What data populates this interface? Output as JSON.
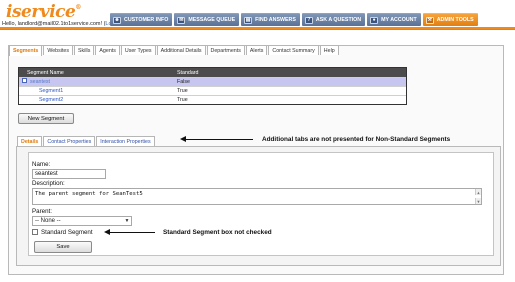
{
  "header": {
    "logo_prefix": "i",
    "logo_text": "service",
    "logo_mark": "®",
    "greeting": "Hello, landlord@mail02.1to1service.com!",
    "logout_open": " (",
    "logout": "Logout",
    "logout_close": ")"
  },
  "nav": {
    "items": [
      {
        "label": "CUSTOMER INFO",
        "icon": "customer-icon"
      },
      {
        "label": "MESSAGE QUEUE",
        "icon": "queue-icon"
      },
      {
        "label": "FIND ANSWERS",
        "icon": "book-icon"
      },
      {
        "label": "ASK A QUESTION",
        "icon": "question-icon"
      },
      {
        "label": "MY ACCOUNT",
        "icon": "account-icon"
      },
      {
        "label": "ADMIN TOOLS",
        "icon": "tools-icon"
      }
    ]
  },
  "tabs": [
    "Segments",
    "Websites",
    "Skills",
    "Agents",
    "User Types",
    "Additional Details",
    "Departments",
    "Alerts",
    "Contact Summary",
    "Help"
  ],
  "segments_table": {
    "headers": [
      "Segment Name",
      "Standard"
    ],
    "rows": [
      {
        "name": "seantest",
        "standard": "False"
      },
      {
        "name": "Segment1",
        "standard": "True"
      },
      {
        "name": "Segment2",
        "standard": "True"
      }
    ]
  },
  "new_segment_label": "New Segment",
  "detail_tabs": [
    "Details",
    "Contact Properties",
    "Interaction Properties"
  ],
  "form": {
    "name_label": "Name:",
    "name_value": "seantest",
    "description_label": "Description:",
    "description_value": "The parent segment for SeanTest5",
    "parent_label": "Parent:",
    "parent_value": "-- None --",
    "standard_label": "Standard Segment",
    "save_label": "Save"
  },
  "annotations": {
    "tabs_note": "Additional tabs are not presented for Non-Standard Segments",
    "checkbox_note": "Standard Segment box not checked"
  },
  "colors": {
    "accent": "#f08a1c",
    "nav": "#6a82a8",
    "selected_row": "#c6c6f0"
  }
}
